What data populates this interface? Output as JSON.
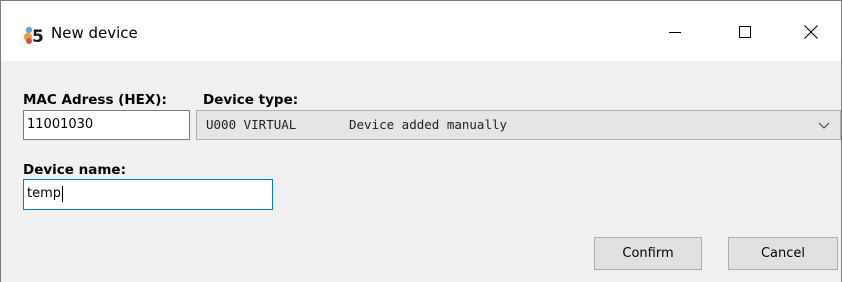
{
  "window": {
    "title": "New device",
    "icon": "app-logo-5-icon"
  },
  "titlebar_buttons": {
    "minimize": "minimize-icon",
    "maximize": "maximize-icon",
    "close": "close-icon"
  },
  "form": {
    "mac_label": "MAC Adress (HEX):",
    "mac_value": "11001030",
    "device_type_label": "Device type:",
    "device_type_code": "U000 VIRTUAL",
    "device_type_desc": "Device added manually",
    "device_name_label": "Device name:",
    "device_name_value": "temp"
  },
  "buttons": {
    "confirm": "Confirm",
    "cancel": "Cancel"
  }
}
